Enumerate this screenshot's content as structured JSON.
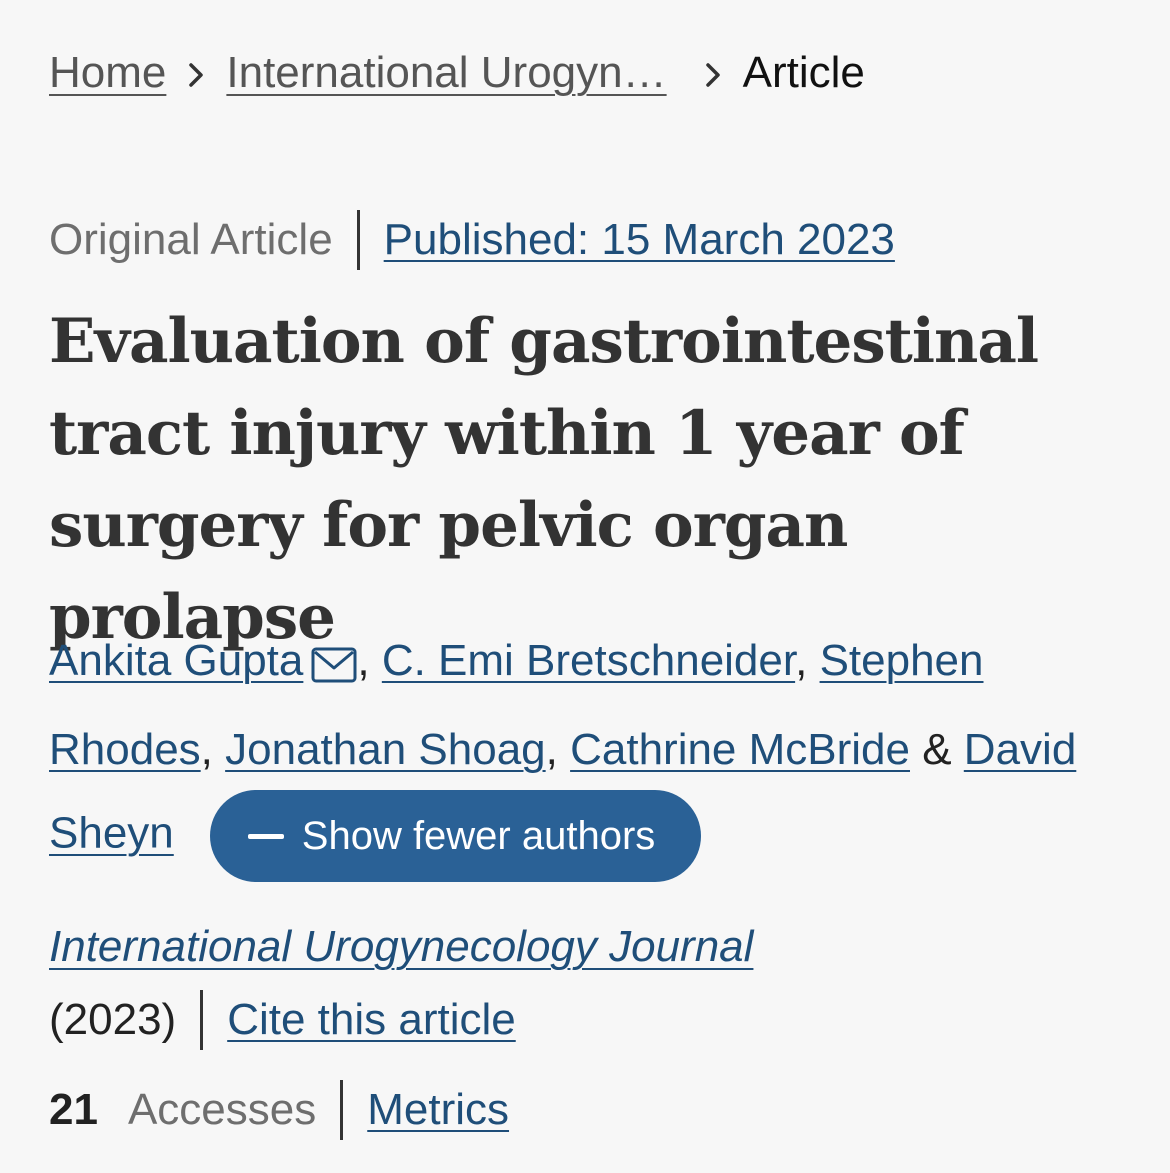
{
  "breadcrumb": {
    "home": "Home",
    "journal": "International Urogyn…",
    "current": "Article"
  },
  "meta": {
    "type": "Original Article",
    "published": "Published: 15 March 2023"
  },
  "title": "Evaluation of gastrointestinal tract injury within 1 year of surgery for pelvic organ prolapse",
  "authors": {
    "list": [
      "Ankita Gupta",
      "C. Emi Bretschneider",
      "Stephen Rhodes",
      "Jonathan Shoag",
      "Cathrine McBride",
      "David Sheyn"
    ],
    "sep": ", ",
    "amp": " & ",
    "toggle_label": "Show fewer authors"
  },
  "journal": {
    "name": "International Urogynecology Journal",
    "year": "(2023)",
    "cite_label": "Cite this article"
  },
  "stats": {
    "accesses_count": "21",
    "accesses_label": "Accesses",
    "metrics_label": "Metrics"
  },
  "icons": {
    "breadcrumb_sep": "chevron-right-icon",
    "corresponding": "envelope-icon",
    "toggle": "minus-icon"
  },
  "colors": {
    "link": "#1f4e79",
    "button": "#2a6196",
    "background": "#f7f7f7"
  }
}
